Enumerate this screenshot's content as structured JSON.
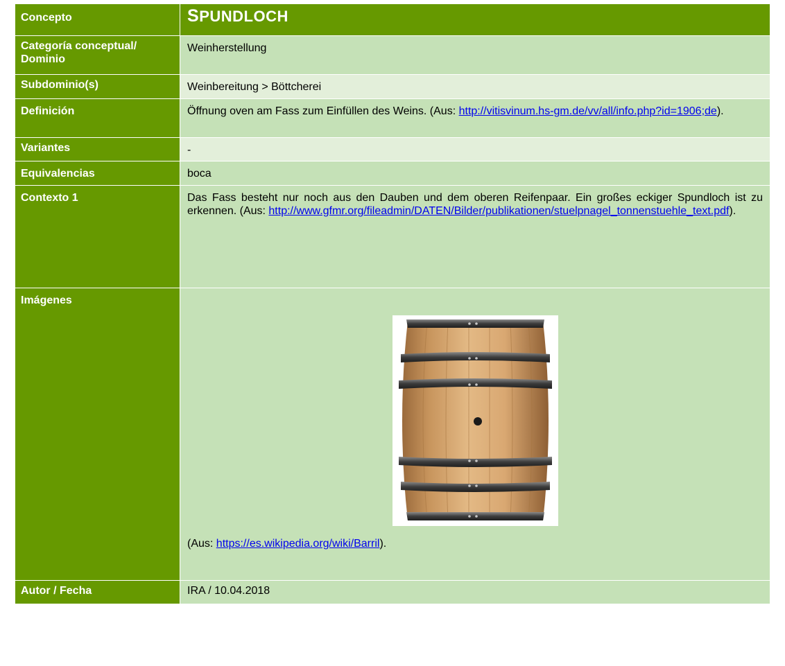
{
  "concepto": {
    "label": "Concepto",
    "title_first": "S",
    "title_rest": "PUNDLOCH"
  },
  "categoria": {
    "label": "Categoría conceptual/ Dominio",
    "value": "Weinherstellung"
  },
  "subdominio": {
    "label": "Subdominio(s)",
    "value": "Weinbereitung > Böttcherei"
  },
  "definicion": {
    "label": "Definición",
    "text": "Öffnung oven am Fass zum Einfüllen des Weins. (Aus: ",
    "link": "http://vitisvinum.hs-gm.de/vv/all/info.php?id=1906;de",
    "suffix": ")."
  },
  "variantes": {
    "label": "Variantes",
    "value": "-"
  },
  "equivalencias": {
    "label": "Equivalencias",
    "value": "boca"
  },
  "contexto": {
    "label": "Contexto 1",
    "text": "Das Fass besteht nur noch aus den Dauben und dem oberen Reifenpaar. Ein großes eckiger Spundloch ist zu erkennen. (Aus: ",
    "link": "http://www.gfmr.org/fileadmin/DATEN/Bilder/publikationen/stuelpnagel_tonnenstuehle_text.pdf",
    "suffix": ")."
  },
  "imagenes": {
    "label": "Imágenes",
    "caption_prefix": "(Aus: ",
    "link": "https://es.wikipedia.org/wiki/Barril",
    "caption_suffix": ")."
  },
  "autor": {
    "label": "Autor / Fecha",
    "value": "IRA / 10.04.2018"
  },
  "colors": {
    "label_bg": "#669900",
    "row_bg": "#c5e1b7",
    "row_bg_alt": "#e3efda",
    "link": "#0000ee"
  }
}
